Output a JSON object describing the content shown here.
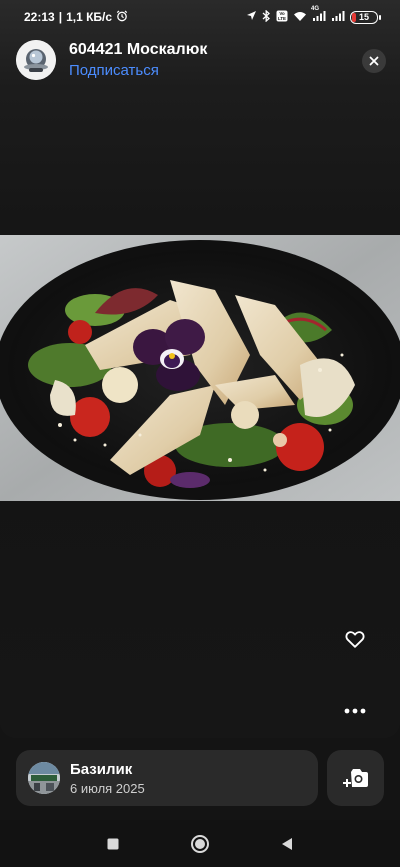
{
  "status_bar": {
    "time": "22:13",
    "speed": "1,1 КБ/с",
    "network": "4G",
    "battery": "15",
    "icons": [
      "alarm-icon",
      "location-icon",
      "bluetooth-icon",
      "volte-icon",
      "wifi-icon",
      "signal-icon",
      "signal-icon",
      "battery-icon"
    ]
  },
  "author": {
    "name": "604421 Москалюк",
    "subscribe_label": "Подписаться"
  },
  "photo": {
    "subject": "salad-with-chicken-and-pansy"
  },
  "actions": {
    "like_icon": "heart-outline-icon",
    "more_icon": "more-horizontal-icon",
    "close_icon": "close-icon",
    "add_photo_icon": "camera-plus-icon"
  },
  "place": {
    "name": "Базилик",
    "date": "6 июля 2025"
  },
  "nav": {
    "icons": [
      "recents-icon",
      "home-icon",
      "back-icon"
    ]
  },
  "colors": {
    "accent_link": "#4c8dff",
    "background": "#141414",
    "card": "#2a2a2a",
    "battery_low": "#e53935"
  }
}
